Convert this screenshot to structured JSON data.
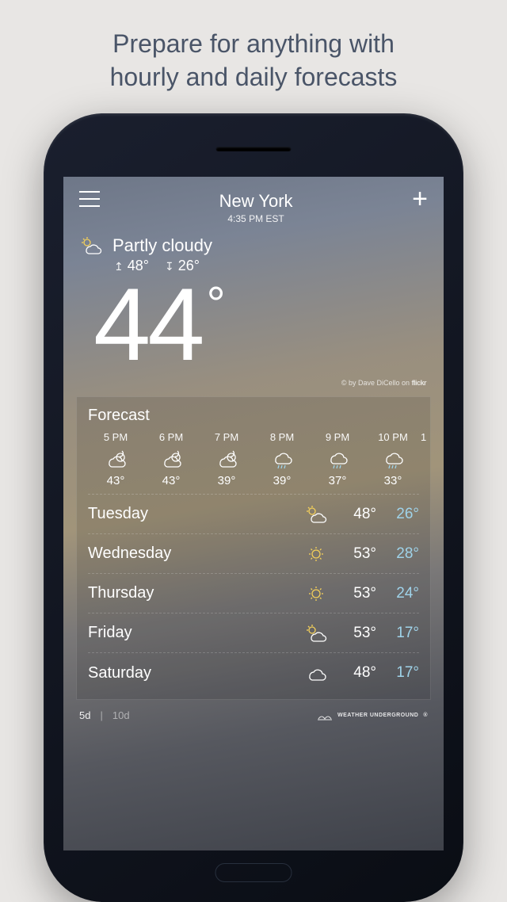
{
  "headline_line1": "Prepare for anything with",
  "headline_line2": "hourly and daily forecasts",
  "location": {
    "name": "New York",
    "time": "4:35 PM EST"
  },
  "current": {
    "condition": "Partly cloudy",
    "high": "48°",
    "low": "26°",
    "temp": "44",
    "degree": "°"
  },
  "photo_credit_prefix": "© by Dave DiCello on ",
  "photo_credit_brand": "flickr",
  "forecast_title": "Forecast",
  "hourly": [
    {
      "label": "5 PM",
      "icon": "night-cloud",
      "temp": "43°"
    },
    {
      "label": "6 PM",
      "icon": "night-cloud",
      "temp": "43°"
    },
    {
      "label": "7 PM",
      "icon": "night-cloud",
      "temp": "39°"
    },
    {
      "label": "8 PM",
      "icon": "rain",
      "temp": "39°"
    },
    {
      "label": "9 PM",
      "icon": "rain",
      "temp": "37°"
    },
    {
      "label": "10 PM",
      "icon": "rain",
      "temp": "33°"
    },
    {
      "label": "1",
      "icon": "",
      "temp": ""
    }
  ],
  "daily": [
    {
      "name": "Tuesday",
      "icon": "partly-sunny",
      "high": "48°",
      "low": "26°"
    },
    {
      "name": "Wednesday",
      "icon": "sunny",
      "high": "53°",
      "low": "28°"
    },
    {
      "name": "Thursday",
      "icon": "sunny",
      "high": "53°",
      "low": "24°"
    },
    {
      "name": "Friday",
      "icon": "partly-sunny",
      "high": "53°",
      "low": "17°"
    },
    {
      "name": "Saturday",
      "icon": "cloudy",
      "high": "48°",
      "low": "17°"
    }
  ],
  "range": {
    "five": "5d",
    "ten": "10d"
  },
  "provider": "WEATHER UNDERGROUND"
}
